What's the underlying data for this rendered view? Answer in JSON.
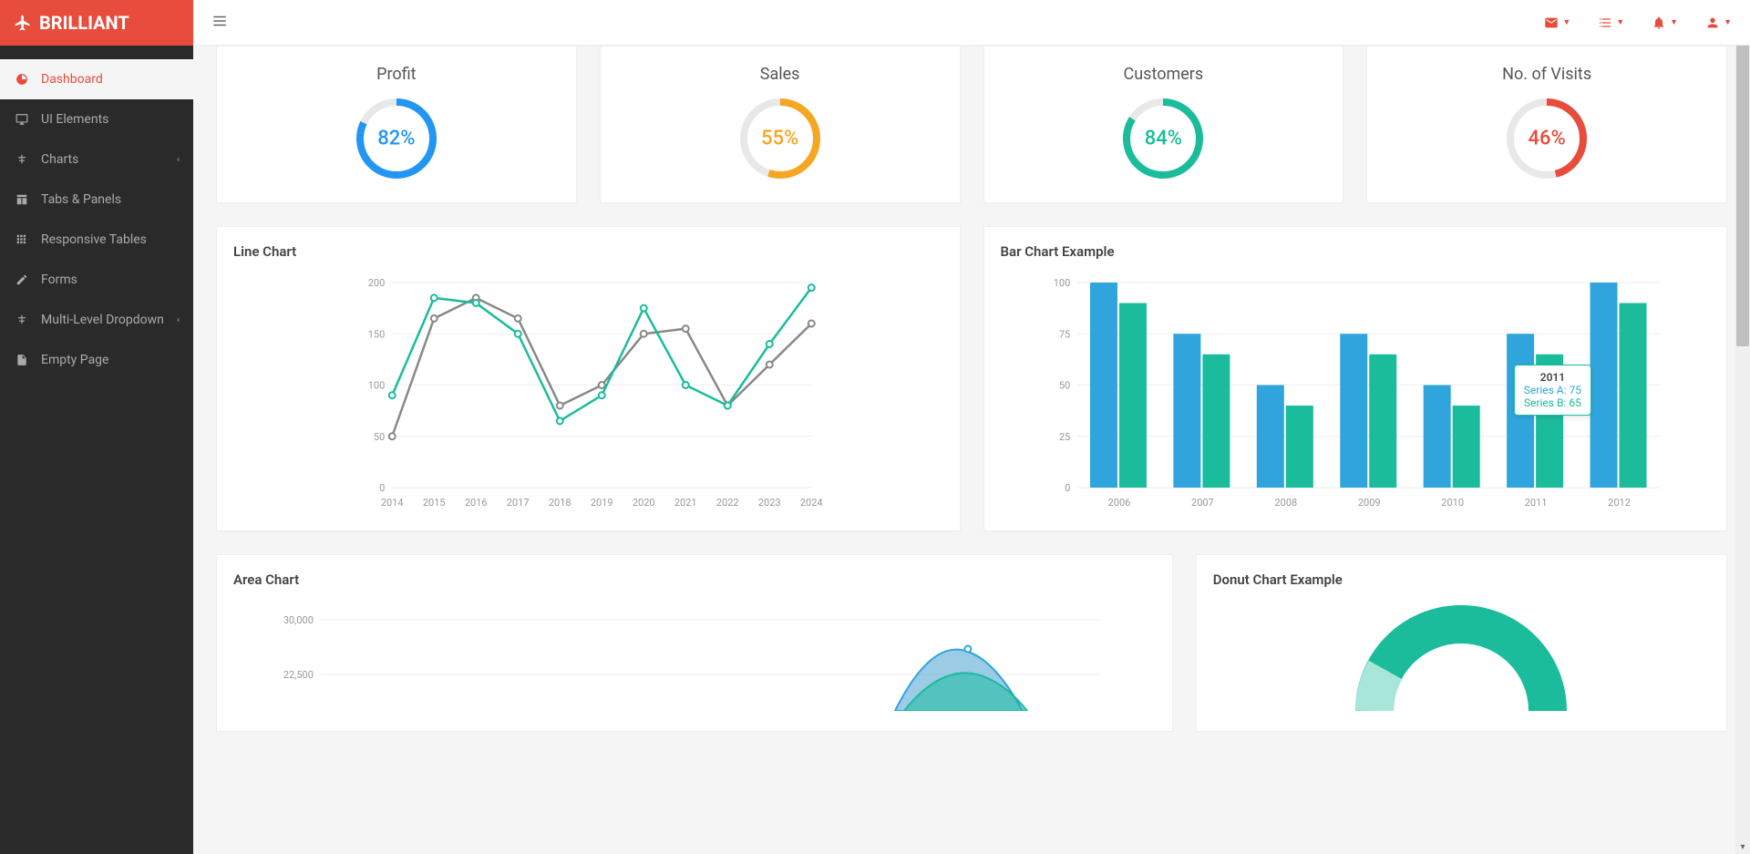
{
  "brand": "BRILLIANT",
  "sidebar": {
    "items": [
      {
        "label": "Dashboard",
        "icon": "dashboard"
      },
      {
        "label": "UI Elements",
        "icon": "desktop"
      },
      {
        "label": "Charts",
        "icon": "sitemap",
        "expandable": true
      },
      {
        "label": "Tabs & Panels",
        "icon": "table"
      },
      {
        "label": "Responsive Tables",
        "icon": "grid"
      },
      {
        "label": "Forms",
        "icon": "edit"
      },
      {
        "label": "Multi-Level Dropdown",
        "icon": "sitemap",
        "expandable": true
      },
      {
        "label": "Empty Page",
        "icon": "file"
      }
    ]
  },
  "stats": [
    {
      "title": "Profit",
      "percent": 82,
      "label": "82%",
      "color": "#2196f3",
      "cls": "c-blue"
    },
    {
      "title": "Sales",
      "percent": 55,
      "label": "55%",
      "color": "#f5a623",
      "cls": "c-orange"
    },
    {
      "title": "Customers",
      "percent": 84,
      "label": "84%",
      "color": "#1abc9c",
      "cls": "c-teal"
    },
    {
      "title": "No. of Visits",
      "percent": 46,
      "label": "46%",
      "color": "#e74c3c",
      "cls": "c-red"
    }
  ],
  "line_chart_title": "Line Chart",
  "bar_chart_title": "Bar Chart Example",
  "area_chart_title": "Area Chart",
  "donut_chart_title": "Donut Chart Example",
  "bar_tooltip": {
    "year": "2011",
    "a": "Series A: 75",
    "b": "Series B: 65"
  },
  "chart_data": [
    {
      "type": "line",
      "title": "Line Chart",
      "x": [
        "2014",
        "2015",
        "2016",
        "2017",
        "2018",
        "2019",
        "2020",
        "2021",
        "2022",
        "2023",
        "2024"
      ],
      "series": [
        {
          "name": "Series A",
          "color": "#888888",
          "values": [
            50,
            165,
            185,
            165,
            80,
            100,
            150,
            155,
            80,
            120,
            160
          ]
        },
        {
          "name": "Series B",
          "color": "#1abc9c",
          "values": [
            90,
            185,
            180,
            150,
            65,
            90,
            175,
            100,
            80,
            140,
            195
          ]
        }
      ],
      "ylim": [
        0,
        200
      ],
      "yticks": [
        0,
        50,
        100,
        150,
        200
      ]
    },
    {
      "type": "bar",
      "title": "Bar Chart Example",
      "categories": [
        "2006",
        "2007",
        "2008",
        "2009",
        "2010",
        "2011",
        "2012"
      ],
      "series": [
        {
          "name": "Series A",
          "color": "#30a5dd",
          "values": [
            100,
            75,
            50,
            75,
            50,
            75,
            100
          ]
        },
        {
          "name": "Series B",
          "color": "#1abc9c",
          "values": [
            90,
            65,
            40,
            65,
            40,
            65,
            90
          ]
        }
      ],
      "ylim": [
        0,
        100
      ],
      "yticks": [
        0,
        25,
        50,
        75,
        100
      ]
    },
    {
      "type": "area",
      "title": "Area Chart",
      "yticks_visible": [
        30000,
        22500
      ],
      "partial": true
    },
    {
      "type": "donut",
      "title": "Donut Chart Example",
      "partial": true
    }
  ]
}
